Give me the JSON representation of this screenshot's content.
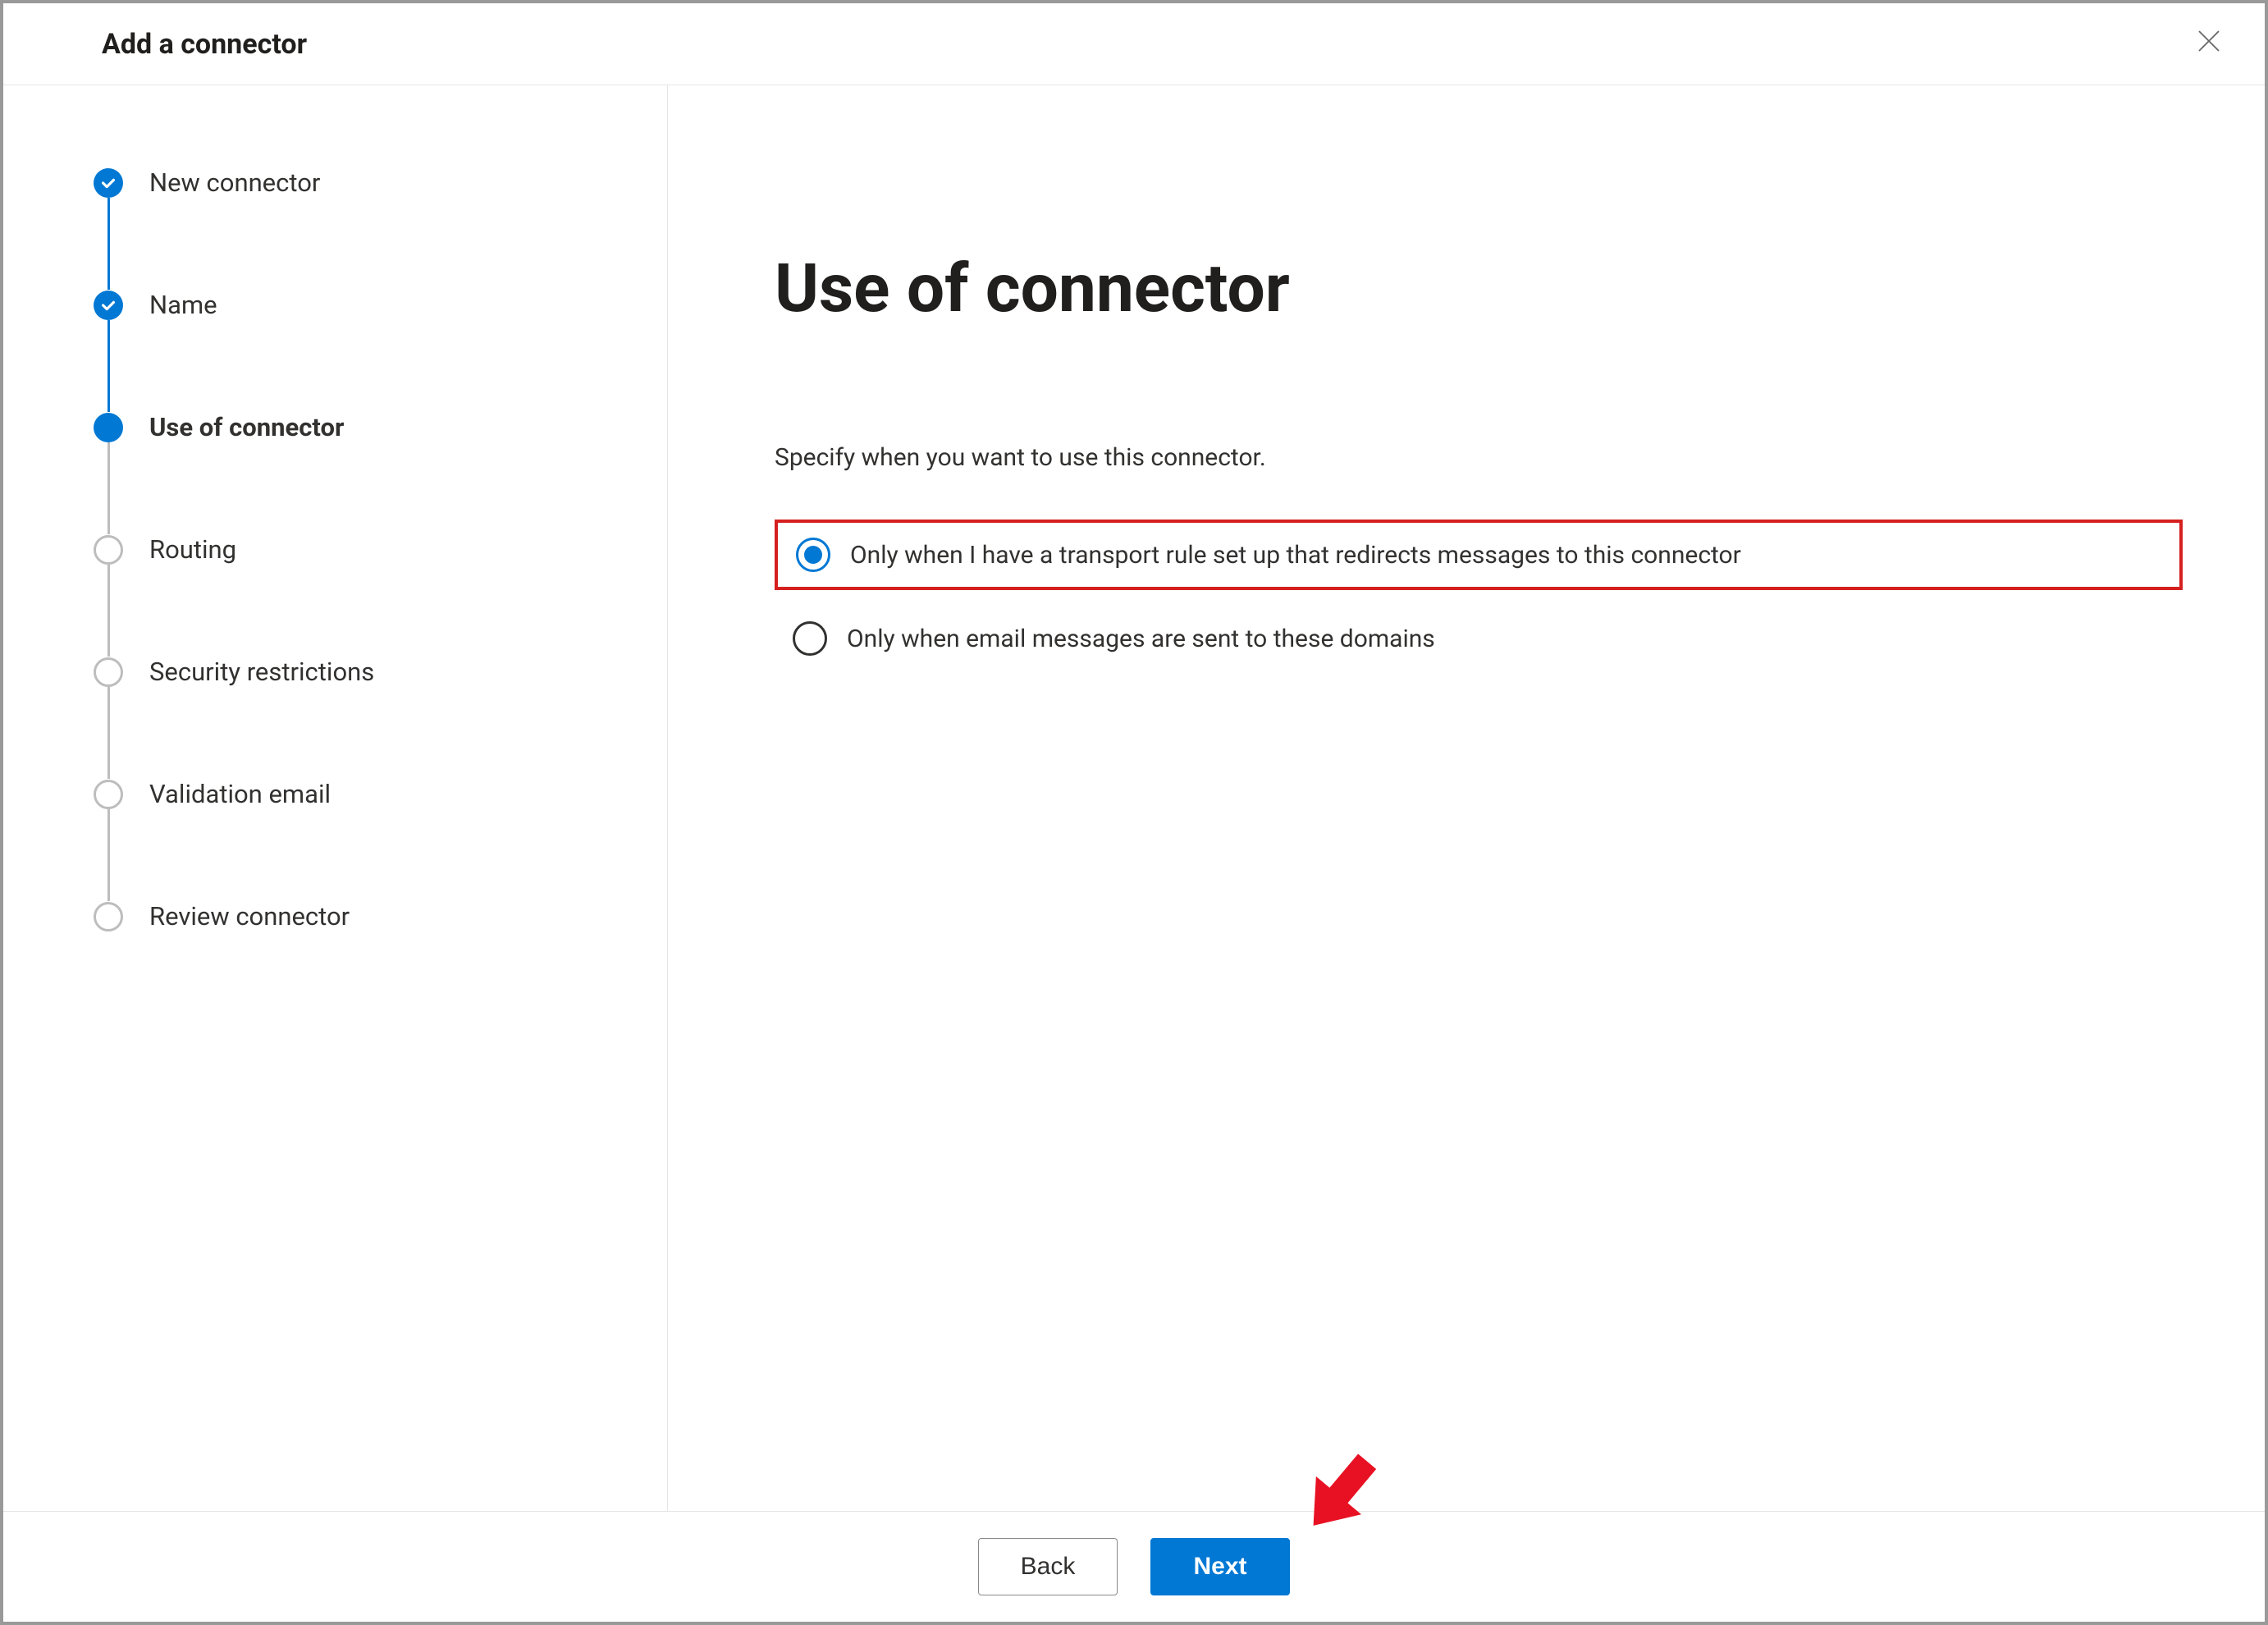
{
  "dialog": {
    "title": "Add a connector"
  },
  "steps": {
    "s0": {
      "label": "New connector"
    },
    "s1": {
      "label": "Name"
    },
    "s2": {
      "label": "Use of connector"
    },
    "s3": {
      "label": "Routing"
    },
    "s4": {
      "label": "Security restrictions"
    },
    "s5": {
      "label": "Validation email"
    },
    "s6": {
      "label": "Review connector"
    }
  },
  "main": {
    "heading": "Use of connector",
    "instruction": "Specify when you want to use this connector.",
    "options": {
      "o0": "Only when I have a transport rule set up that redirects messages to this connector",
      "o1": "Only when email messages are sent to these domains"
    }
  },
  "footer": {
    "back": "Back",
    "next": "Next"
  }
}
